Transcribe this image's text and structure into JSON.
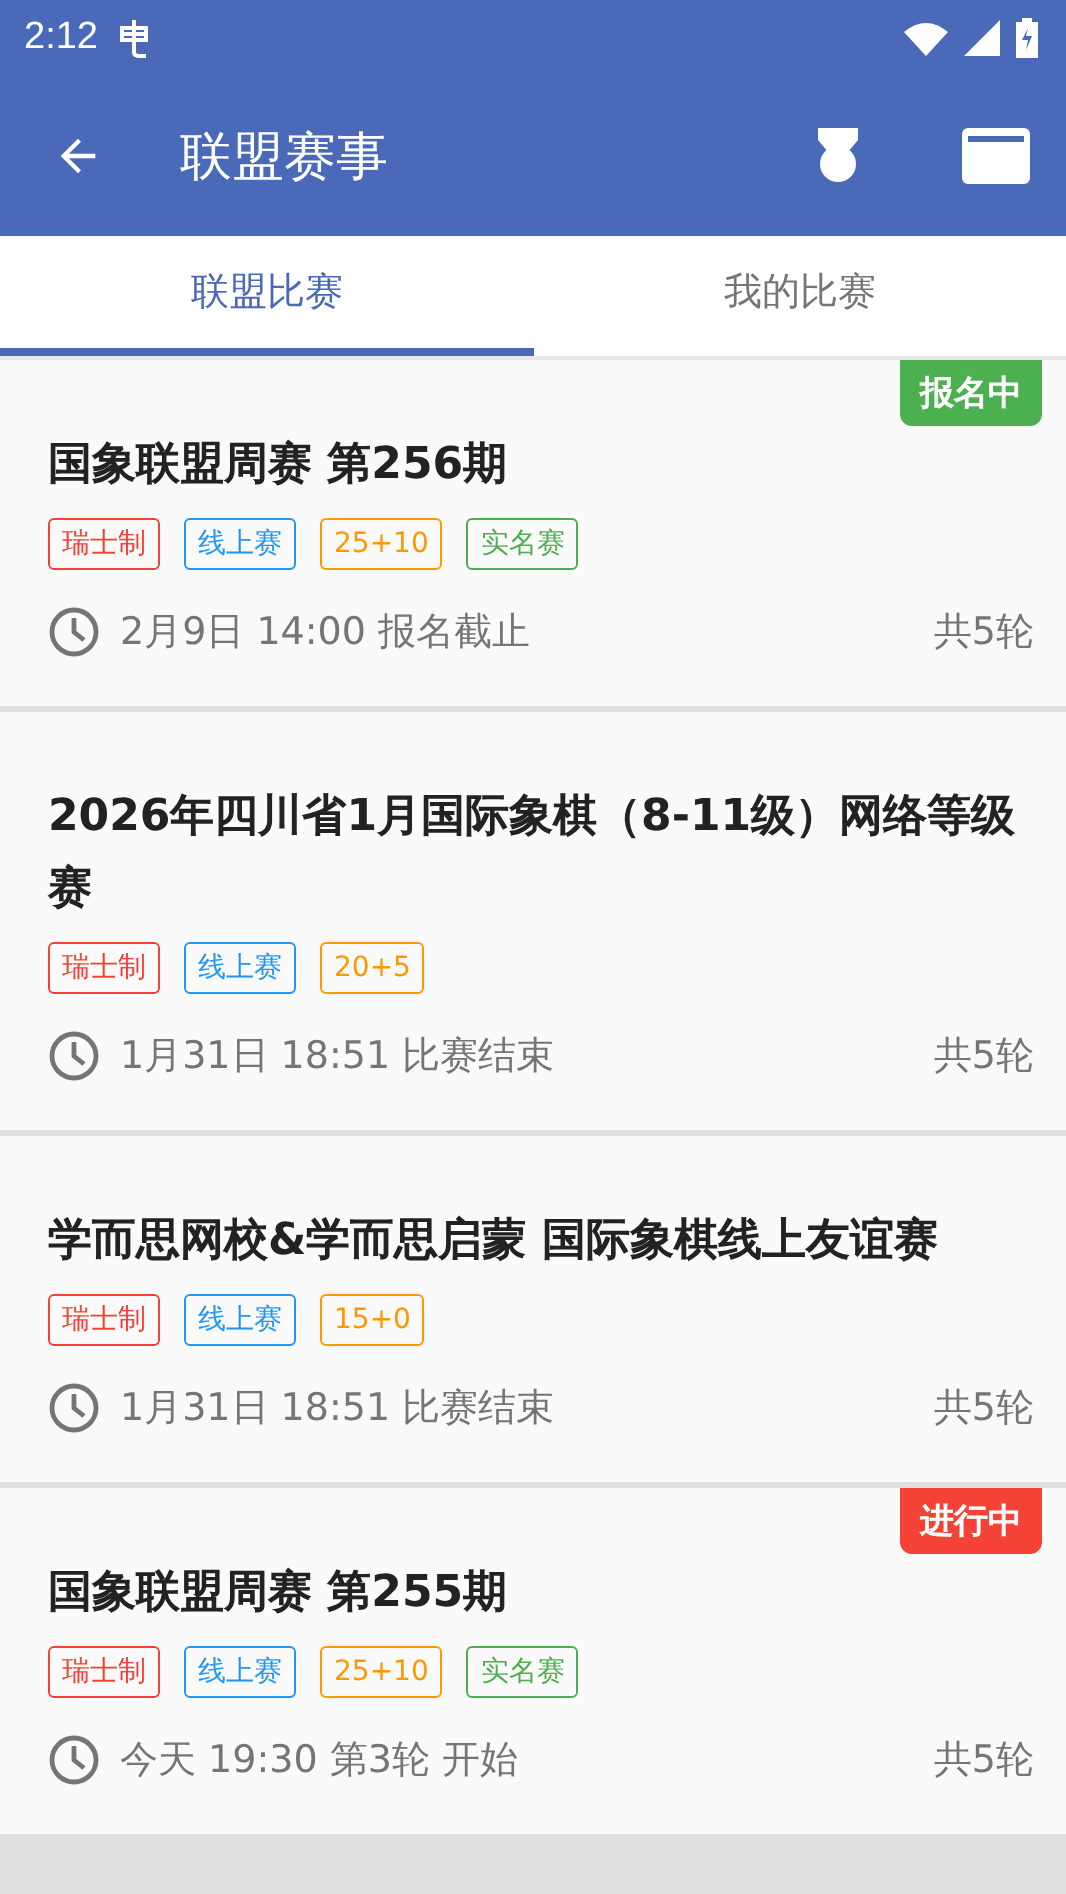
{
  "status_bar": {
    "time": "2:12"
  },
  "app_bar": {
    "title": "联盟赛事"
  },
  "tabs": [
    {
      "label": "联盟比赛",
      "selected": true
    },
    {
      "label": "我的比赛",
      "selected": false
    }
  ],
  "events": [
    {
      "title": "国象联盟周赛 第256期",
      "badge": {
        "text": "报名中",
        "color": "#4caf50"
      },
      "tags": [
        {
          "text": "瑞士制",
          "color": "#f44336"
        },
        {
          "text": "线上赛",
          "color": "#2196f3"
        },
        {
          "text": "25+10",
          "color": "#ff9800"
        },
        {
          "text": "实名赛",
          "color": "#4caf50"
        }
      ],
      "time": "2月9日 14:00 报名截止",
      "rounds": "共5轮"
    },
    {
      "title": "2026年四川省1月国际象棋（8-11级）网络等级赛",
      "tags": [
        {
          "text": "瑞士制",
          "color": "#f44336"
        },
        {
          "text": "线上赛",
          "color": "#2196f3"
        },
        {
          "text": "20+5",
          "color": "#ff9800"
        }
      ],
      "time": "1月31日 18:51 比赛结束",
      "rounds": "共5轮"
    },
    {
      "title": "学而思网校&学而思启蒙 国际象棋线上友谊赛",
      "tags": [
        {
          "text": "瑞士制",
          "color": "#f44336"
        },
        {
          "text": "线上赛",
          "color": "#2196f3"
        },
        {
          "text": "15+0",
          "color": "#ff9800"
        }
      ],
      "time": "1月31日 18:51 比赛结束",
      "rounds": "共5轮"
    },
    {
      "title": "国象联盟周赛 第255期",
      "badge": {
        "text": "进行中",
        "color": "#f44336"
      },
      "tags": [
        {
          "text": "瑞士制",
          "color": "#f44336"
        },
        {
          "text": "线上赛",
          "color": "#2196f3"
        },
        {
          "text": "25+10",
          "color": "#ff9800"
        },
        {
          "text": "实名赛",
          "color": "#4caf50"
        }
      ],
      "time": "今天 19:30 第3轮 开始",
      "rounds": "共5轮"
    }
  ]
}
